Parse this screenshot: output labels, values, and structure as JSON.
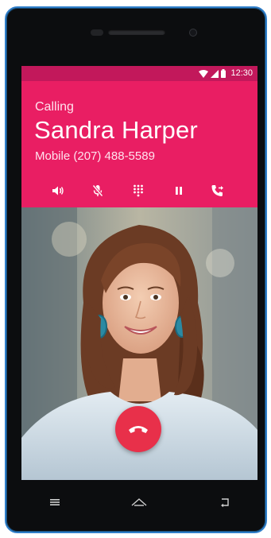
{
  "status_bar": {
    "time": "12:30"
  },
  "call": {
    "state": "Calling",
    "name": "Sandra Harper",
    "number": "Mobile (207) 488-5589"
  },
  "controls": [
    {
      "name": "speaker",
      "icon": "speaker-icon"
    },
    {
      "name": "mute",
      "icon": "mic-off-icon"
    },
    {
      "name": "dialpad",
      "icon": "dialpad-icon"
    },
    {
      "name": "hold",
      "icon": "pause-icon"
    },
    {
      "name": "add-call",
      "icon": "phone-forward-icon"
    }
  ],
  "colors": {
    "header": "#e91e63",
    "status_bar": "#c2185b",
    "end_call": "#e8304a",
    "phone_border": "#2f7ec9"
  },
  "nav_keys": [
    "menu-icon",
    "home-icon",
    "back-icon"
  ]
}
